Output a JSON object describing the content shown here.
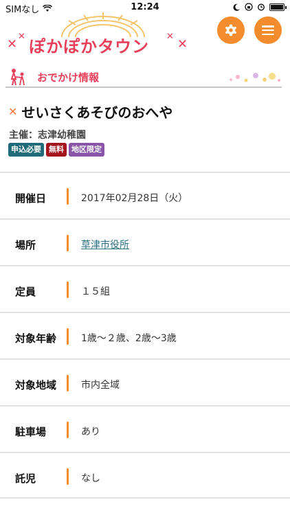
{
  "status_bar": {
    "carrier": "SIMなし",
    "time": "12:24"
  },
  "header": {
    "logo_text": "ぽかぽかタウン",
    "settings_icon": "gear-icon",
    "menu_icon": "hamburger-icon"
  },
  "category": {
    "label": "おでかけ情報"
  },
  "event": {
    "title": "せいさくあそびのおへや",
    "organizer": "主催：志津幼稚園",
    "tags": [
      {
        "label": "申込必要",
        "color": "#1f6b7a"
      },
      {
        "label": "無料",
        "color": "#a3141c"
      },
      {
        "label": "地区限定",
        "color": "#8a55a8"
      }
    ]
  },
  "info": [
    {
      "label": "開催日",
      "value": "2017年02月28日（火）",
      "link": false
    },
    {
      "label": "場所",
      "value": "草津市役所",
      "link": true
    },
    {
      "label": "定員",
      "value": "１５組",
      "link": false
    },
    {
      "label": "対象年齢",
      "value": "1歳〜２歳、2歳〜3歳",
      "link": false
    },
    {
      "label": "対象地域",
      "value": "市内全域",
      "link": false
    },
    {
      "label": "駐車場",
      "value": "あり",
      "link": false
    },
    {
      "label": "託児",
      "value": "なし",
      "link": false
    }
  ],
  "colors": {
    "accent_orange": "#f28c2d",
    "logo_pink": "#e8405a"
  }
}
